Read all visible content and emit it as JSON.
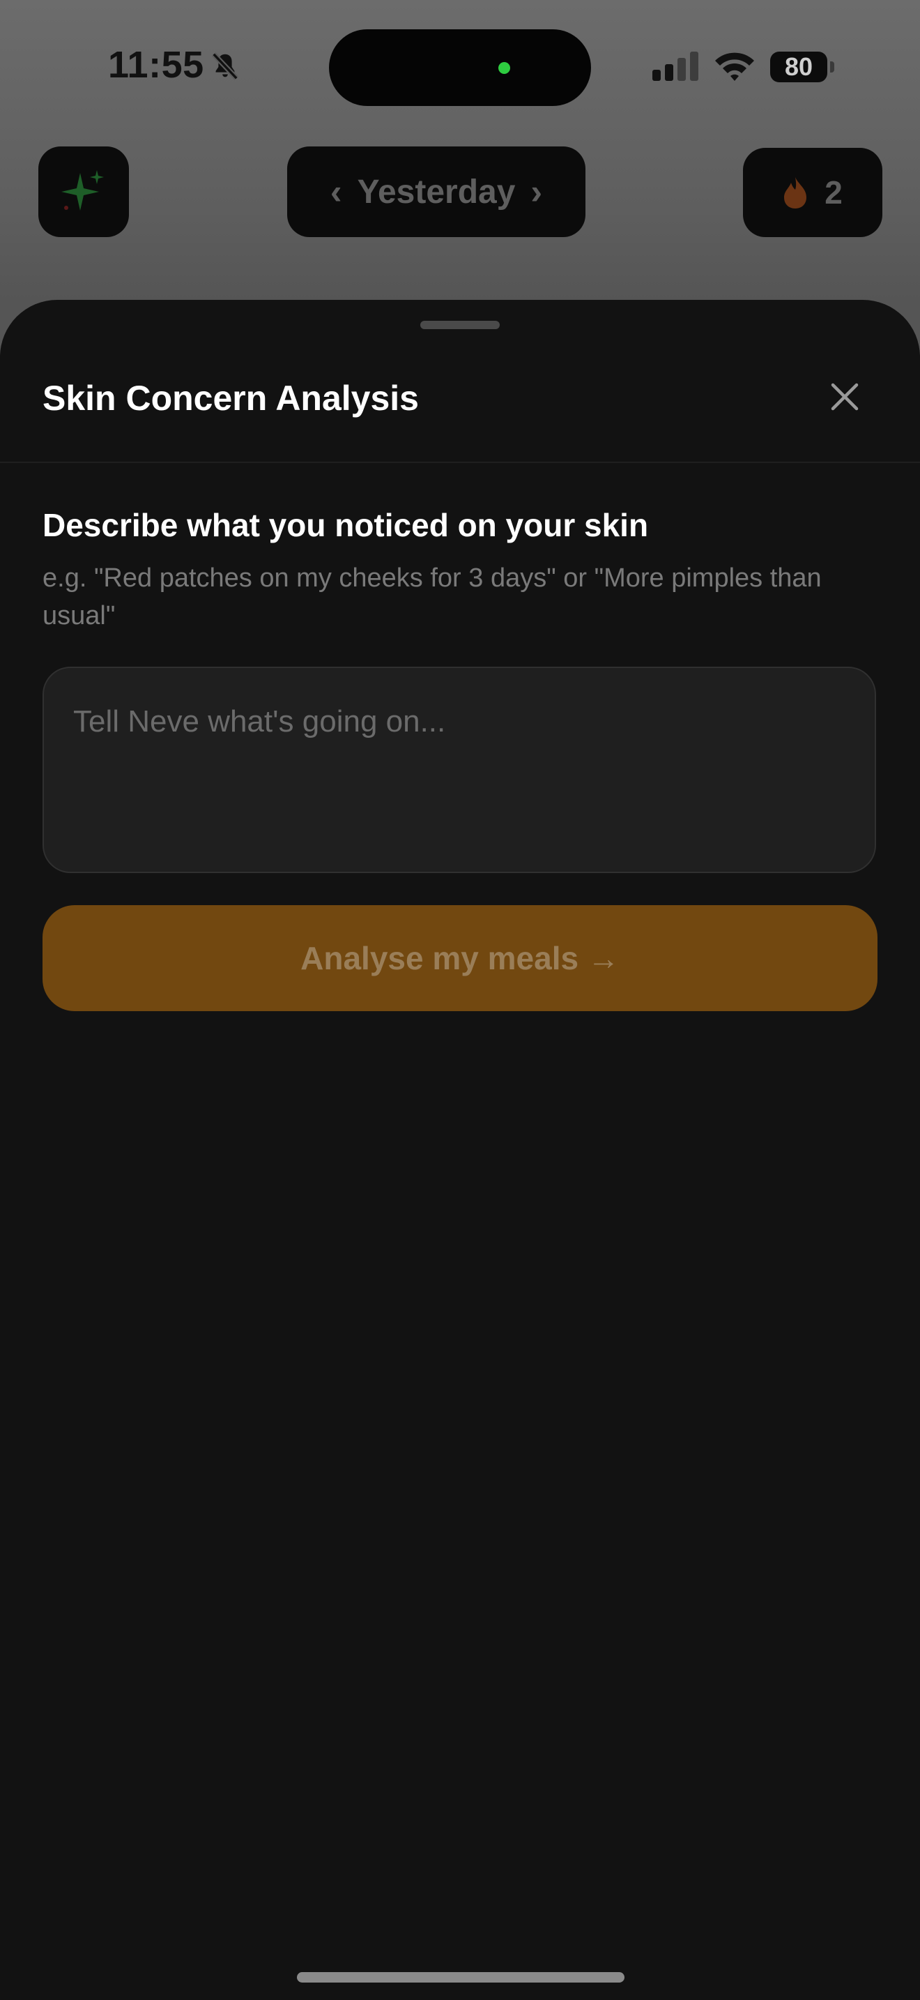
{
  "status_bar": {
    "time": "11:55",
    "battery": "80",
    "icons": [
      "bell-slash-icon",
      "cellular-signal-icon",
      "wifi-icon",
      "battery-icon"
    ]
  },
  "top_bar": {
    "left_icon": "sparkle-icon",
    "date_label": "Yesterday",
    "prev_symbol": "‹",
    "next_symbol": "›",
    "streak_icon": "flame-icon",
    "streak_count": "2"
  },
  "sheet": {
    "title": "Skin Concern Analysis",
    "close_icon": "close-icon",
    "prompt_heading": "Describe what you noticed on your skin",
    "prompt_hint": "e.g. \"Red patches on my cheeks for 3 days\" or \"More pimples than usual\"",
    "input_placeholder": "Tell Neve what's going on...",
    "input_value": "",
    "submit_label": "Analyse my meals →",
    "submit_enabled": false
  },
  "colors": {
    "sheet_background": "#121212",
    "accent": "#724810",
    "accent_text": "#9a7e58",
    "input_background": "#1f1f1f",
    "muted_text": "#7a7a7a"
  }
}
